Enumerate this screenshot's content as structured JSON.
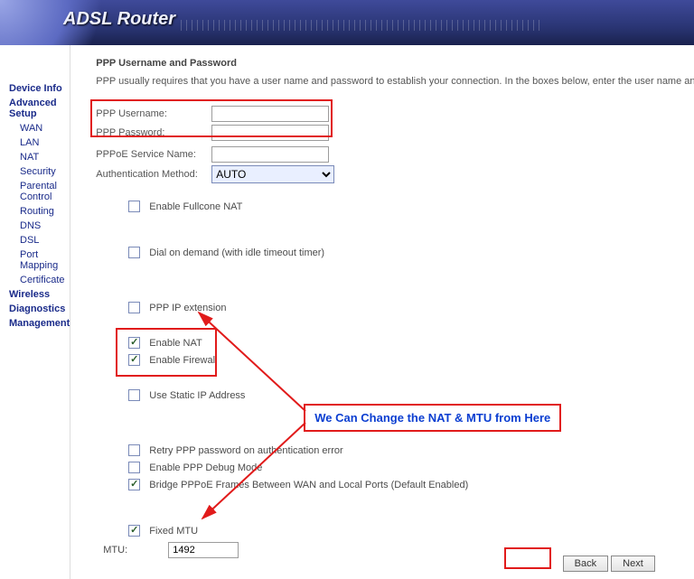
{
  "banner": {
    "title": "ADSL Router"
  },
  "sidebar": {
    "items": [
      {
        "label": "Device Info",
        "sub": false
      },
      {
        "label": "Advanced Setup",
        "sub": false
      },
      {
        "label": "WAN",
        "sub": true
      },
      {
        "label": "LAN",
        "sub": true
      },
      {
        "label": "NAT",
        "sub": true
      },
      {
        "label": "Security",
        "sub": true
      },
      {
        "label": "Parental Control",
        "sub": true
      },
      {
        "label": "Routing",
        "sub": true
      },
      {
        "label": "DNS",
        "sub": true
      },
      {
        "label": "DSL",
        "sub": true
      },
      {
        "label": "Port Mapping",
        "sub": true
      },
      {
        "label": "Certificate",
        "sub": true
      },
      {
        "label": "Wireless",
        "sub": false
      },
      {
        "label": "Diagnostics",
        "sub": false
      },
      {
        "label": "Management",
        "sub": false
      }
    ]
  },
  "page": {
    "title": "PPP Username and Password",
    "description": "PPP usually requires that you have a user name and password to establish your connection. In the boxes below, enter the user name and p"
  },
  "fields": {
    "username_label": "PPP Username:",
    "username_value": "",
    "password_label": "PPP Password:",
    "password_value": "",
    "service_label": "PPPoE Service Name:",
    "service_value": "",
    "auth_label": "Authentication Method:",
    "auth_value": "AUTO",
    "mtu_label": "MTU:",
    "mtu_value": "1492"
  },
  "checks": {
    "fullcone": "Enable Fullcone NAT",
    "dial": "Dial on demand (with idle timeout timer)",
    "ipext": "PPP IP extension",
    "nat": "Enable NAT",
    "firewall": "Enable Firewall",
    "staticip": "Use Static IP Address",
    "retry": "Retry PPP password on authentication error",
    "debug": "Enable PPP Debug Mode",
    "bridge": "Bridge PPPoE Frames Between WAN and Local Ports (Default Enabled)",
    "fixedmtu": "Fixed MTU"
  },
  "buttons": {
    "back": "Back",
    "next": "Next"
  },
  "annotation": {
    "text": "We Can Change the NAT & MTU from Here"
  }
}
